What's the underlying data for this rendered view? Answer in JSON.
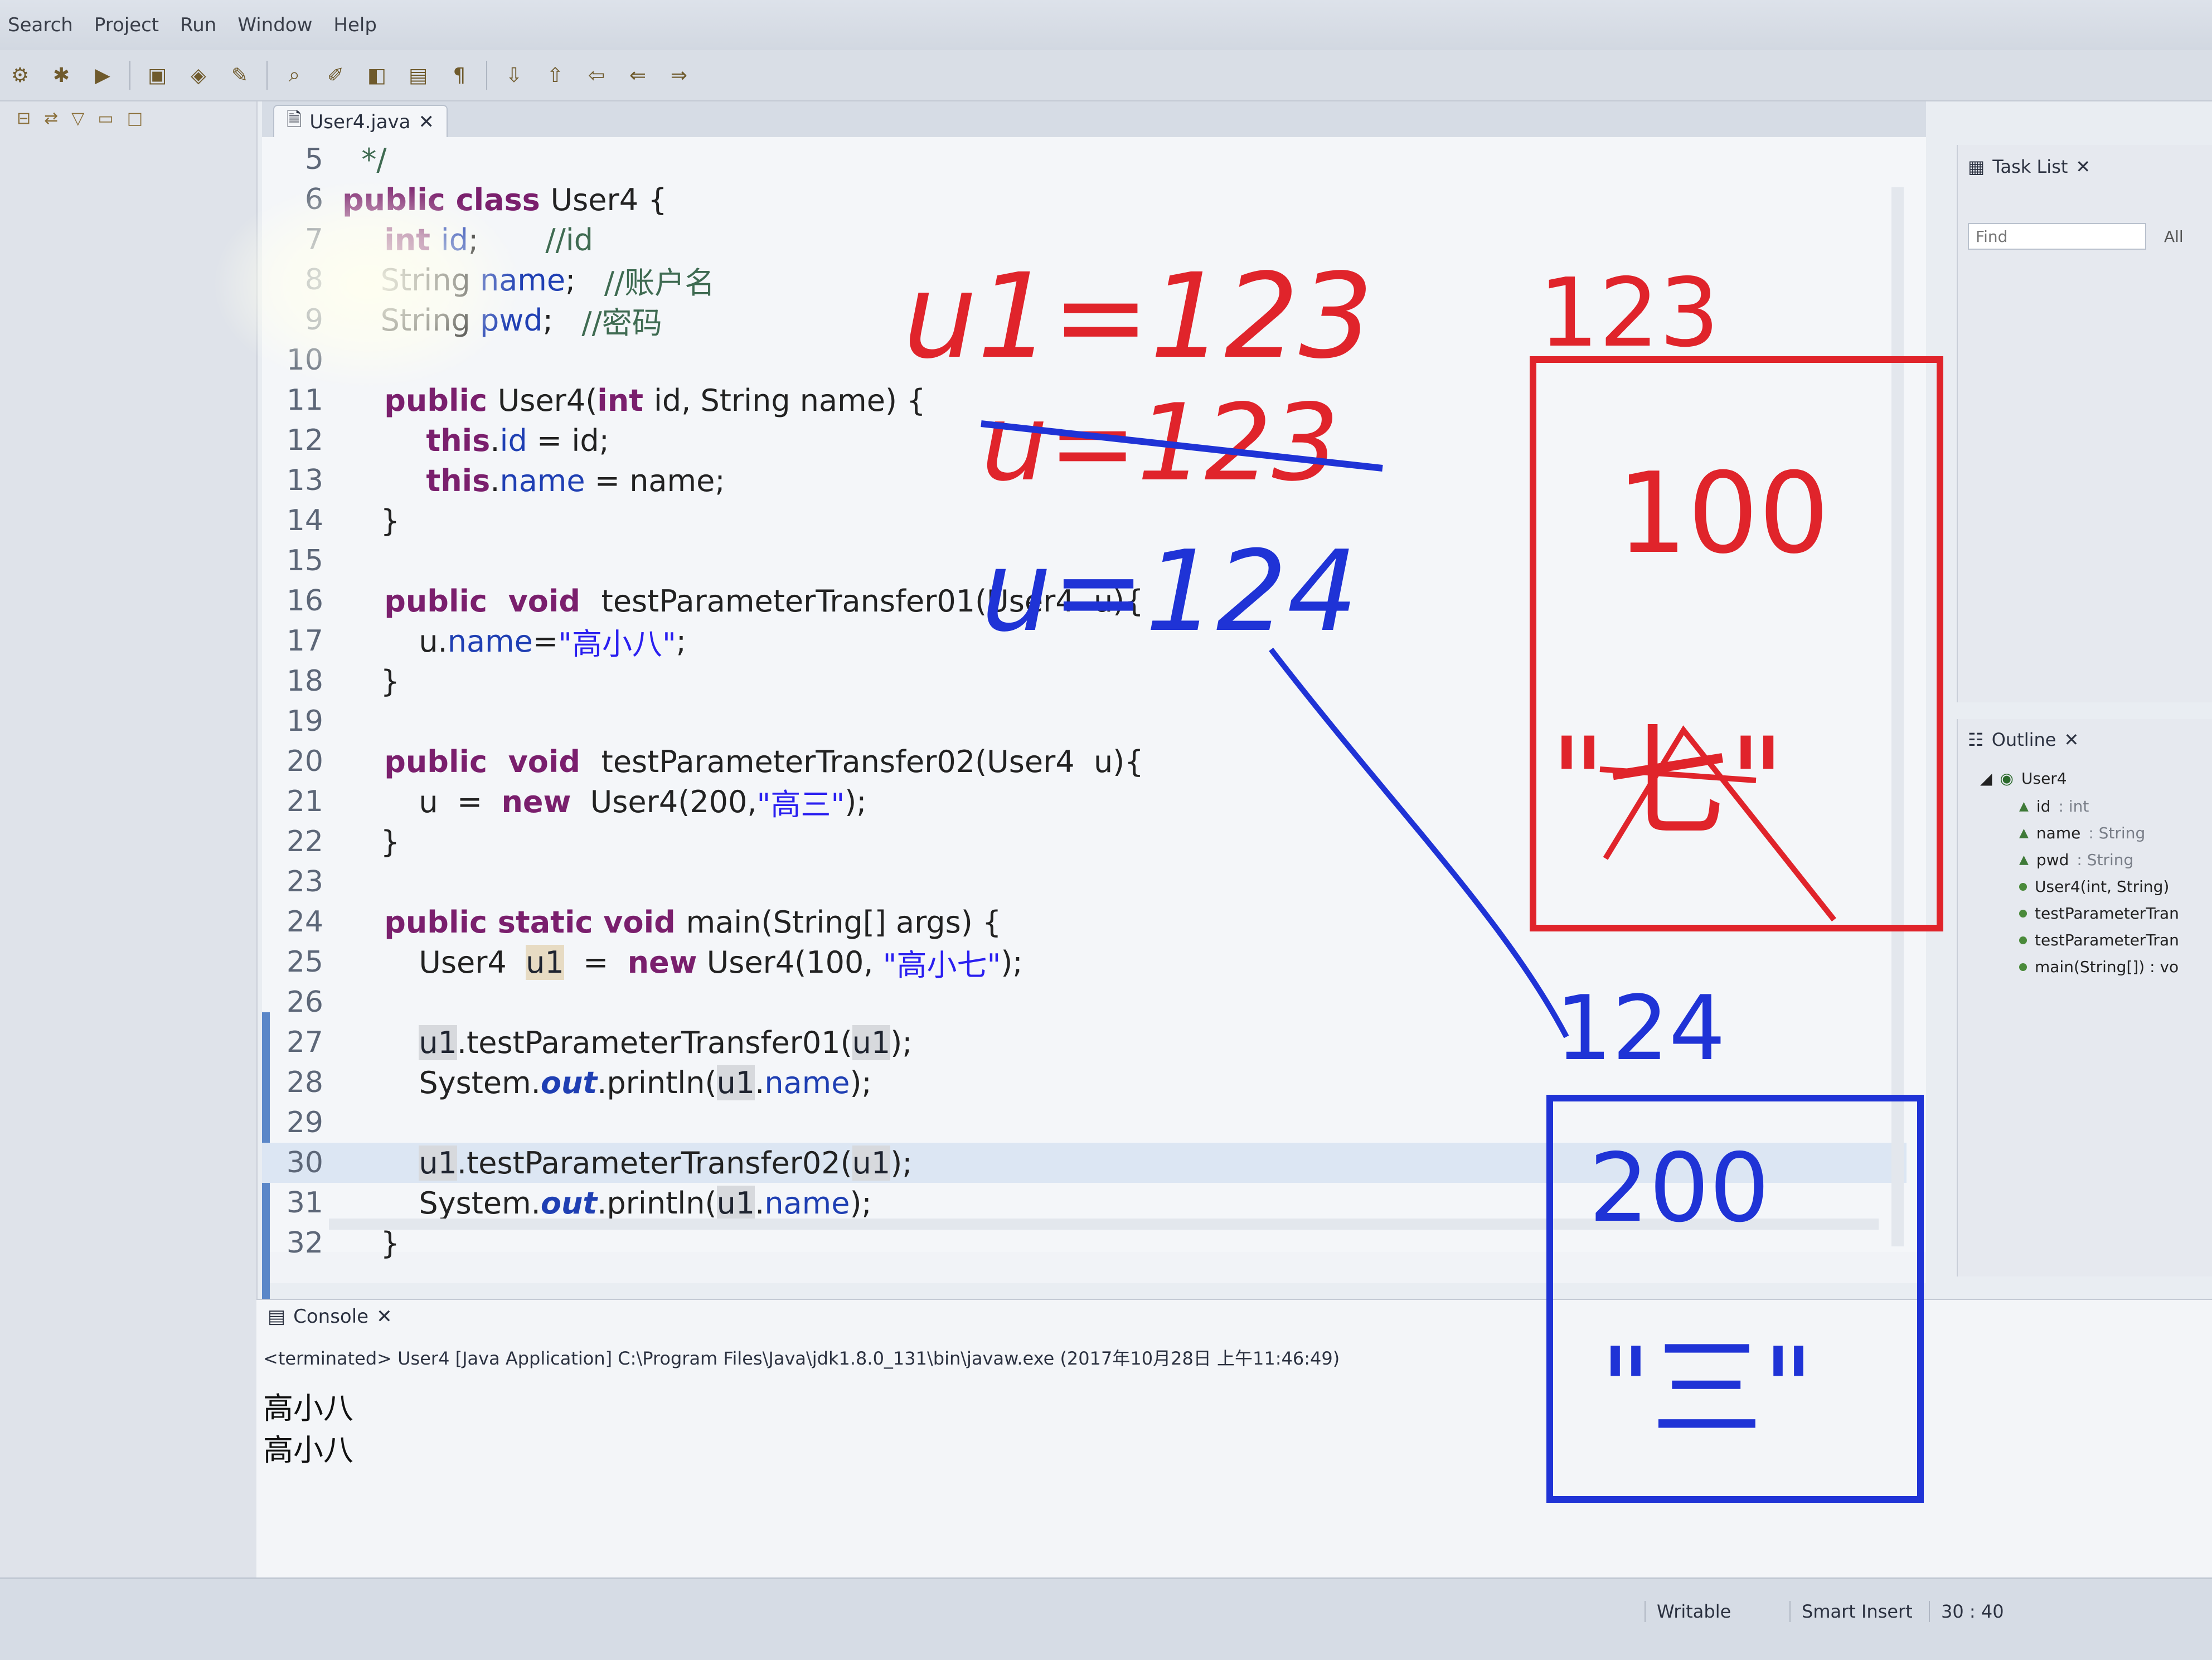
{
  "menu": {
    "items": [
      "Search",
      "Project",
      "Run",
      "Window",
      "Help"
    ]
  },
  "editor": {
    "tab_label": "User4.java",
    "lines": [
      {
        "n": "5",
        "segs": [
          {
            "t": "  */",
            "c": "cmt"
          }
        ]
      },
      {
        "n": "6",
        "segs": [
          {
            "t": "public class ",
            "c": "kw"
          },
          {
            "t": "User4 {",
            "c": "txt"
          }
        ]
      },
      {
        "n": "7",
        "segs": [
          {
            "t": "    int ",
            "c": "kw"
          },
          {
            "t": "id",
            "c": "fld"
          },
          {
            "t": ";       ",
            "c": "txt"
          },
          {
            "t": "//id",
            "c": "cmt"
          }
        ]
      },
      {
        "n": "8",
        "segs": [
          {
            "t": "    String ",
            "c": "txt"
          },
          {
            "t": "name",
            "c": "fld"
          },
          {
            "t": ";   ",
            "c": "txt"
          },
          {
            "t": "//账户名",
            "c": "cmt"
          }
        ]
      },
      {
        "n": "9",
        "segs": [
          {
            "t": "    String ",
            "c": "txt"
          },
          {
            "t": "pwd",
            "c": "fld"
          },
          {
            "t": ";   ",
            "c": "txt"
          },
          {
            "t": "//密码",
            "c": "cmt"
          }
        ]
      },
      {
        "n": "10",
        "segs": []
      },
      {
        "n": "11",
        "segs": [
          {
            "t": "    public ",
            "c": "kw"
          },
          {
            "t": "User4(",
            "c": "txt"
          },
          {
            "t": "int ",
            "c": "kw"
          },
          {
            "t": "id, String name) {",
            "c": "txt"
          }
        ]
      },
      {
        "n": "12",
        "segs": [
          {
            "t": "        this",
            "c": "kw"
          },
          {
            "t": ".",
            "c": "txt"
          },
          {
            "t": "id",
            "c": "fld"
          },
          {
            "t": " = id;",
            "c": "txt"
          }
        ]
      },
      {
        "n": "13",
        "segs": [
          {
            "t": "        this",
            "c": "kw"
          },
          {
            "t": ".",
            "c": "txt"
          },
          {
            "t": "name",
            "c": "fld"
          },
          {
            "t": " = name;",
            "c": "txt"
          }
        ]
      },
      {
        "n": "14",
        "segs": [
          {
            "t": "    }",
            "c": "txt"
          }
        ]
      },
      {
        "n": "15",
        "segs": []
      },
      {
        "n": "16",
        "segs": [
          {
            "t": "    public  void  ",
            "c": "kw"
          },
          {
            "t": "testParameterTransfer01(User4  u){",
            "c": "txt"
          }
        ]
      },
      {
        "n": "17",
        "segs": [
          {
            "t": "        u.",
            "c": "txt"
          },
          {
            "t": "name",
            "c": "fld"
          },
          {
            "t": "=",
            "c": "txt"
          },
          {
            "t": "\"高小八\"",
            "c": "str"
          },
          {
            "t": ";",
            "c": "txt"
          }
        ]
      },
      {
        "n": "18",
        "segs": [
          {
            "t": "    }",
            "c": "txt"
          }
        ]
      },
      {
        "n": "19",
        "segs": []
      },
      {
        "n": "20",
        "segs": [
          {
            "t": "    public  void  ",
            "c": "kw"
          },
          {
            "t": "testParameterTransfer02(User4  u){",
            "c": "txt"
          }
        ]
      },
      {
        "n": "21",
        "segs": [
          {
            "t": "        u  =  ",
            "c": "txt"
          },
          {
            "t": "new",
            "c": "kw"
          },
          {
            "t": "  User4(200,",
            "c": "txt"
          },
          {
            "t": "\"高三\"",
            "c": "str"
          },
          {
            "t": ");",
            "c": "txt"
          }
        ]
      },
      {
        "n": "22",
        "segs": [
          {
            "t": "    }",
            "c": "txt"
          }
        ]
      },
      {
        "n": "23",
        "segs": []
      },
      {
        "n": "24",
        "segs": [
          {
            "t": "    public static void ",
            "c": "kw"
          },
          {
            "t": "main(String[] args) {",
            "c": "txt"
          }
        ]
      },
      {
        "n": "25",
        "segs": [
          {
            "t": "        User4  ",
            "c": "txt"
          },
          {
            "t": "u1",
            "c": "occ"
          },
          {
            "t": "  =  ",
            "c": "txt"
          },
          {
            "t": "new",
            "c": "kw"
          },
          {
            "t": " User4(100, ",
            "c": "txt"
          },
          {
            "t": "\"高小七\"",
            "c": "str"
          },
          {
            "t": ");",
            "c": "txt"
          }
        ]
      },
      {
        "n": "26",
        "segs": []
      },
      {
        "n": "27",
        "segs": [
          {
            "t": "        ",
            "c": "txt"
          },
          {
            "t": "u1",
            "c": "occ2"
          },
          {
            "t": ".testParameterTransfer01(",
            "c": "txt"
          },
          {
            "t": "u1",
            "c": "occ2"
          },
          {
            "t": ");",
            "c": "txt"
          }
        ]
      },
      {
        "n": "28",
        "segs": [
          {
            "t": "        System.",
            "c": "txt"
          },
          {
            "t": "out",
            "c": "ital"
          },
          {
            "t": ".println(",
            "c": "txt"
          },
          {
            "t": "u1",
            "c": "occ2"
          },
          {
            "t": ".",
            "c": "txt"
          },
          {
            "t": "name",
            "c": "fld"
          },
          {
            "t": ");",
            "c": "txt"
          }
        ]
      },
      {
        "n": "29",
        "segs": []
      },
      {
        "n": "30",
        "segs": [
          {
            "t": "        ",
            "c": "txt"
          },
          {
            "t": "u1",
            "c": "occ2"
          },
          {
            "t": ".testParameterTransfer02(",
            "c": "txt"
          },
          {
            "t": "u1",
            "c": "occ2"
          },
          {
            "t": ");",
            "c": "txt"
          }
        ]
      },
      {
        "n": "31",
        "segs": [
          {
            "t": "        System.",
            "c": "txt"
          },
          {
            "t": "out",
            "c": "ital"
          },
          {
            "t": ".println(",
            "c": "txt"
          },
          {
            "t": "u1",
            "c": "occ2"
          },
          {
            "t": ".",
            "c": "txt"
          },
          {
            "t": "name",
            "c": "fld"
          },
          {
            "t": ");",
            "c": "txt"
          }
        ]
      },
      {
        "n": "32",
        "segs": [
          {
            "t": "    }",
            "c": "txt"
          }
        ]
      }
    ],
    "current_line": "30"
  },
  "console": {
    "tab_label": "Console",
    "status": "<terminated> User4 [Java Application] C:\\Program Files\\Java\\jdk1.8.0_131\\bin\\javaw.exe (2017年10月28日 上午11:46:49)",
    "output": [
      "高小八",
      "高小八"
    ]
  },
  "task_list": {
    "title": "Task List",
    "find_placeholder": "Find",
    "all_label": "All"
  },
  "outline": {
    "title": "Outline",
    "class_name": "User4",
    "members": [
      {
        "name": "id",
        "type": ": int"
      },
      {
        "name": "name",
        "type": ": String"
      },
      {
        "name": "pwd",
        "type": ": String"
      },
      {
        "name": "User4(int, String)",
        "type": ""
      },
      {
        "name": "testParameterTran",
        "type": ""
      },
      {
        "name": "testParameterTran",
        "type": ""
      },
      {
        "name": "main(String[]) : vo",
        "type": ""
      }
    ]
  },
  "statusbar": {
    "writable": "Writable",
    "insert_mode": "Smart Insert",
    "position": "30 : 40"
  },
  "annotations": {
    "red_line1": "u1=123",
    "red_box_label": "123",
    "red_value": "100",
    "red_name_scribble": "\"七\"",
    "blue_line2": "u=123",
    "blue_line3": "u=124",
    "blue_box_label": "124",
    "blue_value": "200",
    "blue_name_scribble": "\"三\"",
    "colors": {
      "red": "#e0242b",
      "blue": "#1f33d6"
    }
  }
}
